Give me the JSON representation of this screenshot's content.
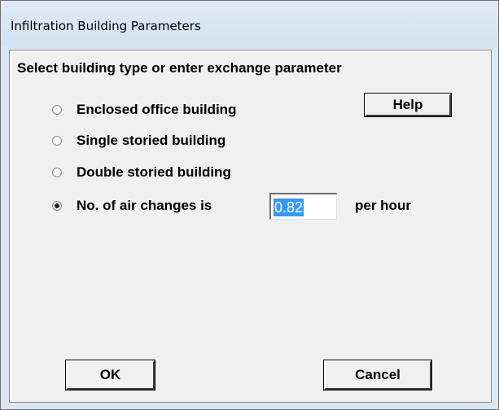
{
  "window": {
    "title": "Infiltration Building Parameters"
  },
  "dialog": {
    "heading": "Select building type or enter exchange parameter",
    "help_label": "Help",
    "options": [
      {
        "label": "Enclosed office building",
        "checked": false
      },
      {
        "label": "Single storied building",
        "checked": false
      },
      {
        "label": "Double storied building",
        "checked": false
      },
      {
        "label": "No. of air changes is",
        "checked": true
      }
    ],
    "air_changes_value": "0.82",
    "air_changes_unit": "per hour",
    "ok_label": "OK",
    "cancel_label": "Cancel"
  },
  "colors": {
    "selection_highlight": "#3399ff",
    "titlebar": "#dbe6f4",
    "dialog_face": "#f0f0f0"
  }
}
